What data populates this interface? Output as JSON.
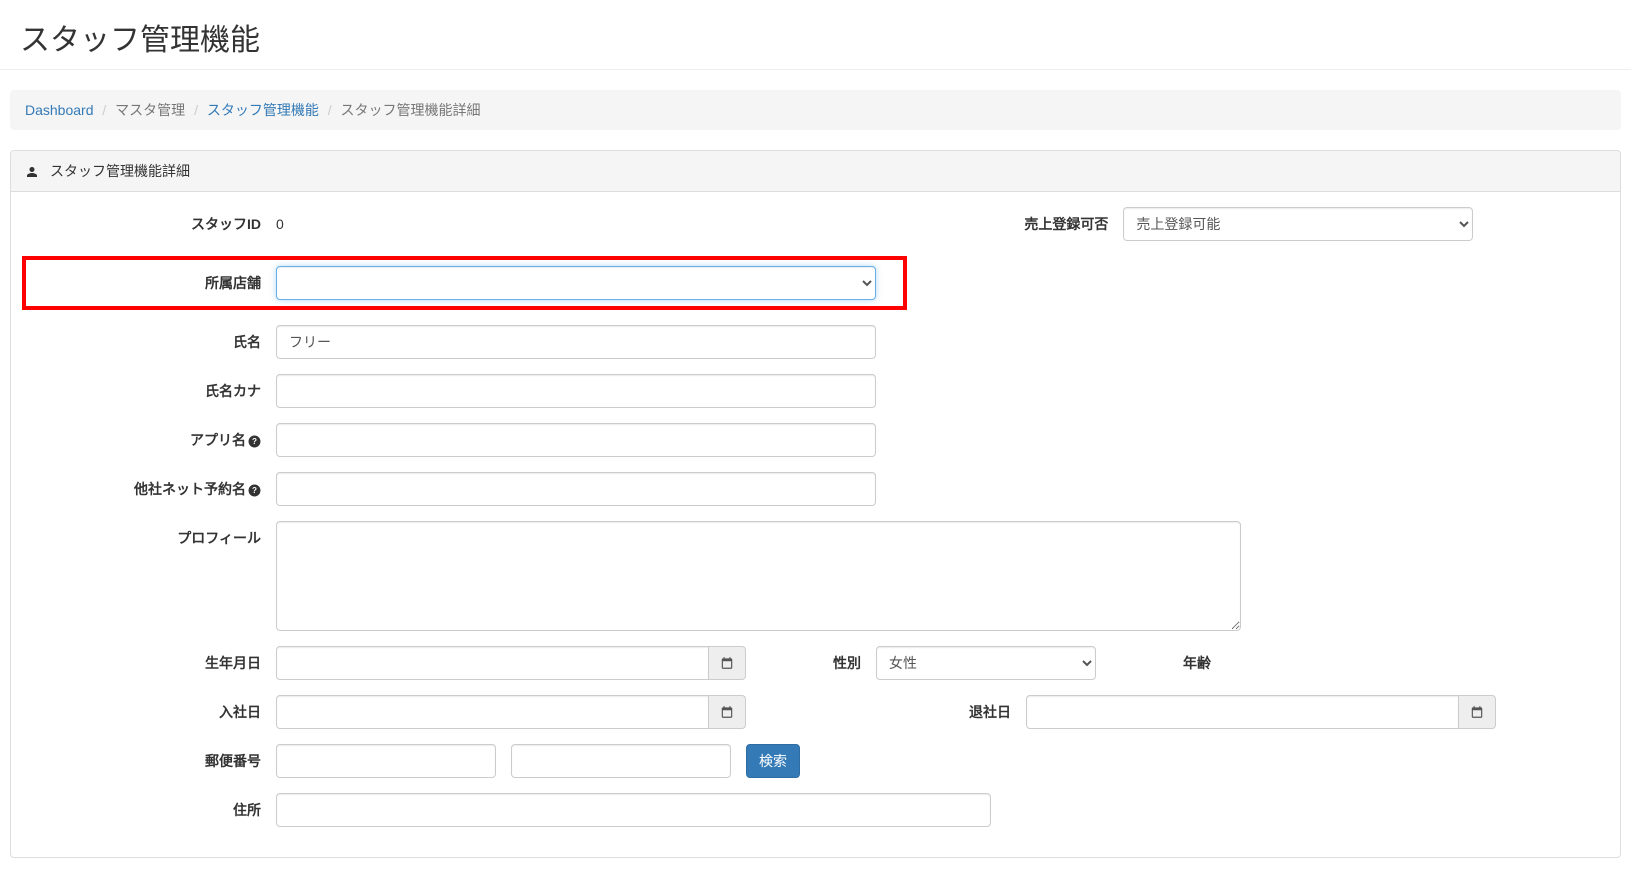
{
  "page_title": "スタッフ管理機能",
  "breadcrumb": {
    "dashboard": "Dashboard",
    "master": "マスタ管理",
    "staff_mgmt": "スタッフ管理機能",
    "detail": "スタッフ管理機能詳細"
  },
  "panel": {
    "heading": "スタッフ管理機能詳細"
  },
  "labels": {
    "staff_id": "スタッフID",
    "sales_reg": "売上登録可否",
    "store": "所属店舗",
    "name": "氏名",
    "name_kana": "氏名カナ",
    "app_name": "アプリ名",
    "other_net": "他社ネット予約名",
    "profile": "プロフィール",
    "birthday": "生年月日",
    "gender": "性別",
    "age": "年齢",
    "join_date": "入社日",
    "leave_date": "退社日",
    "postal": "郵便番号",
    "search": "検索",
    "address": "住所"
  },
  "values": {
    "staff_id": "0",
    "sales_reg_option": "売上登録可能",
    "store": "",
    "name": "フリー",
    "name_kana": "",
    "app_name": "",
    "other_net": "",
    "profile": "",
    "birthday": "",
    "gender_option": "女性",
    "age": "",
    "join_date": "",
    "leave_date": "",
    "postal1": "",
    "postal2": "",
    "address": ""
  }
}
